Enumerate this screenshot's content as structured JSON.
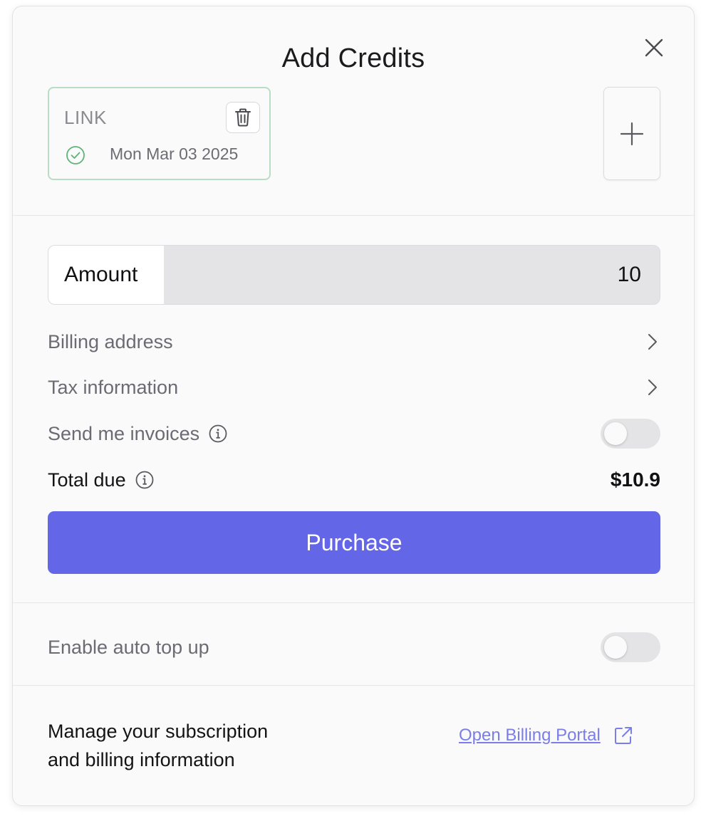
{
  "dialog": {
    "title": "Add Credits",
    "close_icon": "close-icon"
  },
  "payment_card": {
    "brand": "LINK",
    "date": "Mon Mar 03 2025",
    "status_icon": "check-circle-icon",
    "delete_icon": "trash-icon"
  },
  "add_payment": {
    "icon": "plus-icon"
  },
  "amount": {
    "label": "Amount",
    "value": "10"
  },
  "billing_address": {
    "label": "Billing address",
    "icon": "chevron-right-icon"
  },
  "tax_information": {
    "label": "Tax information",
    "icon": "chevron-right-icon"
  },
  "send_invoices": {
    "label": "Send me invoices",
    "icon": "info-icon",
    "enabled": false
  },
  "total_due": {
    "label": "Total due",
    "value": "$10.9",
    "icon": "info-icon"
  },
  "purchase": {
    "label": "Purchase"
  },
  "auto_top_up": {
    "label": "Enable auto top up",
    "enabled": false
  },
  "billing_portal": {
    "description_line1": "Manage your subscription",
    "description_line2": "and billing information",
    "link_label": "Open Billing Portal",
    "icon": "external-link-icon"
  },
  "colors": {
    "accent": "#6466e8",
    "link": "#7b7de8",
    "card_border": "#b9ddc3",
    "success": "#5fb37a"
  }
}
